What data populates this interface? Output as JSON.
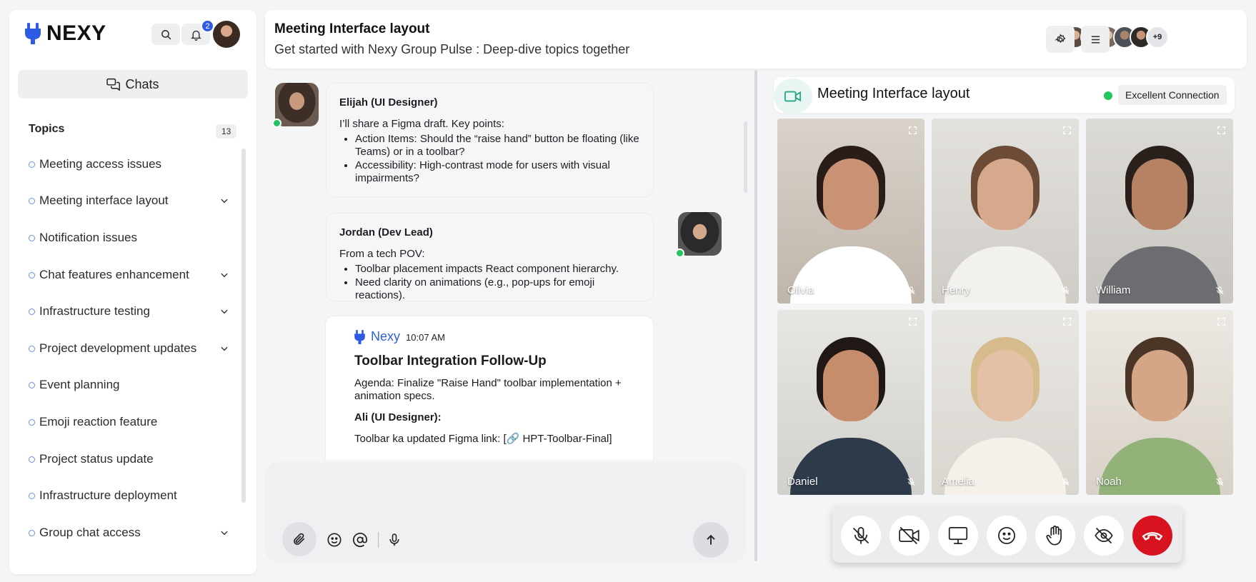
{
  "app": {
    "brand": "NEXY",
    "notification_count": "2",
    "accent": "#2d5be3"
  },
  "sidebar": {
    "chats_label": "Chats",
    "topics_label": "Topics",
    "topics_count": "13",
    "items": [
      {
        "label": "Meeting access issues",
        "expandable": false
      },
      {
        "label": "Meeting interface layout",
        "expandable": true
      },
      {
        "label": "Notification issues",
        "expandable": false
      },
      {
        "label": "Chat features enhancement",
        "expandable": true
      },
      {
        "label": "Infrastructure testing",
        "expandable": true
      },
      {
        "label": "Project development updates",
        "expandable": true
      },
      {
        "label": "Event planning",
        "expandable": false
      },
      {
        "label": "Emoji reaction feature",
        "expandable": false
      },
      {
        "label": "Project status update",
        "expandable": false
      },
      {
        "label": "Infrastructure deployment",
        "expandable": false
      },
      {
        "label": "Group chat access",
        "expandable": true
      }
    ]
  },
  "header": {
    "title": "Meeting Interface layout",
    "subtitle": "Get started with Nexy Group Pulse : Deep-dive topics together",
    "more_participants": "+9"
  },
  "chat": {
    "messages": [
      {
        "author": "Elijah (UI Designer)",
        "intro": "I’ll share a Figma draft. Key points:",
        "bullets": [
          "Action Items: Should the “raise hand” button be floating (like Teams) or in a toolbar?",
          "Accessibility: High-contrast mode for users with visual impairments?"
        ]
      },
      {
        "author": "Jordan (Dev Lead)",
        "intro": "From a tech POV:",
        "bullets": [
          "Toolbar placement impacts React component hierarchy.",
          "Need clarity on animations (e.g., pop-ups for emoji reactions)."
        ]
      }
    ],
    "bot": {
      "name": "Nexy",
      "time": "10:07 AM",
      "title": "Toolbar Integration Follow-Up",
      "agenda": "Agenda: Finalize \"Raise Hand\" toolbar implementation + animation specs.",
      "sub_author": "Ali (UI Designer):",
      "link_text": "Toolbar ka updated Figma link: [🔗 HPT-Toolbar-Final]"
    }
  },
  "composer": {
    "placeholder": ""
  },
  "meeting": {
    "title": "Meeting Interface layout",
    "connection": "Excellent Connection",
    "participants": [
      {
        "name": "Olivia"
      },
      {
        "name": "Henry"
      },
      {
        "name": "William"
      },
      {
        "name": "Daniel"
      },
      {
        "name": "Amelia"
      },
      {
        "name": "Noah"
      }
    ]
  }
}
